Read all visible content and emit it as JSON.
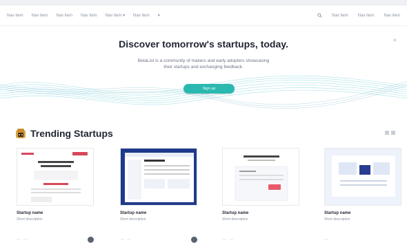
{
  "nav": {
    "left_items": [
      "Nav item",
      "Nav item",
      "Nav item",
      "Nav item",
      "Nav item ▾",
      "Nav item",
      "▾"
    ],
    "right_items": [
      "Nav item",
      "Nav item",
      "Nav item"
    ],
    "search_icon": "search-icon"
  },
  "hero": {
    "title": "Discover tomorrow's startups, today.",
    "subtitle": "BetaList is a community of makers and early adopters showcasing their startups and exchanging feedback.",
    "cta_label": "Sign up",
    "close_label": "×"
  },
  "section": {
    "title": "Trending Startups",
    "icon": "trending-icon"
  },
  "colors": {
    "accent": "#2bb8b0",
    "wave": "#5fc7d4",
    "heading": "#1f2430"
  },
  "startups": [
    {
      "name": "Startup name",
      "description": "Short description",
      "stat_a": "",
      "stat_b": ""
    },
    {
      "name": "Startup name",
      "description": "Short description",
      "stat_a": "",
      "stat_b": ""
    },
    {
      "name": "Startup name",
      "description": "Short description",
      "stat_a": "",
      "stat_b": ""
    },
    {
      "name": "Startup name",
      "description": "Short description",
      "stat_a": "",
      "stat_b": ""
    }
  ]
}
